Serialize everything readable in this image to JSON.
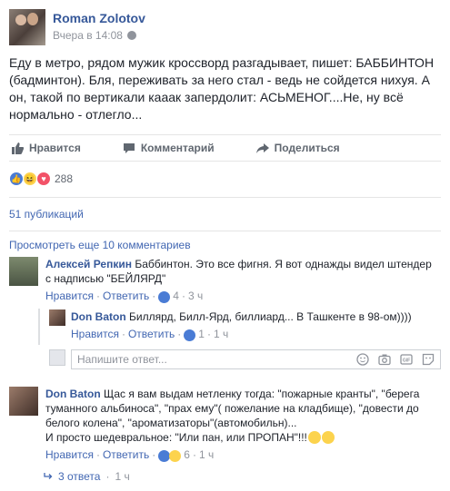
{
  "post": {
    "author": "Roman Zolotov",
    "time": "Вчера в 14:08",
    "text": "Еду в метро, рядом мужик кроссворд разгадывает, пишет: БАББИНТОН (бадминтон). Бля, переживать за него стал - ведь не сойдется нихуя. А он, такой по вертикали кааак запердолит: АСЬМЕНОГ....Не, ну всё нормально - отлегло..."
  },
  "actions": {
    "like": "Нравится",
    "comment": "Комментарий",
    "share": "Поделиться"
  },
  "reactions": {
    "count": "288"
  },
  "shares": "51 публикаций",
  "more_comments": "Просмотреть еще 10 комментариев",
  "comments": [
    {
      "author": "Алексей Репкин",
      "text": "Баббинтон. Это все фигня. Я вот однажды видел штендер с надписью \"БЕЙЛЯРД\"",
      "like": "Нравится",
      "reply": "Ответить",
      "likes": "4",
      "age": "3 ч"
    },
    {
      "author": "Don Baton",
      "text": "Биллярд, Билл-Ярд, биллиард... В Ташкенте в 98-ом))))",
      "like": "Нравится",
      "reply": "Ответить",
      "likes": "1",
      "age": "1 ч"
    },
    {
      "author": "Don Baton",
      "text": "Щас я вам выдам нетленку тогда: \"пожарные кранты\", \"берега туманного альбиноса\", \"прах ему\"( пожелание на кладбище), \"довести до белого колена\", \"ароматизаторы\"(автомобильн)...",
      "text2": "И просто шедевральное: \"Или пан, или ПРОПАН\"!!!",
      "like": "Нравится",
      "reply": "Ответить",
      "likes": "6",
      "age": "1 ч"
    }
  ],
  "reply_input": {
    "placeholder": "Напишите ответ..."
  },
  "replies": {
    "label": "3 ответа",
    "age": "1 ч"
  }
}
